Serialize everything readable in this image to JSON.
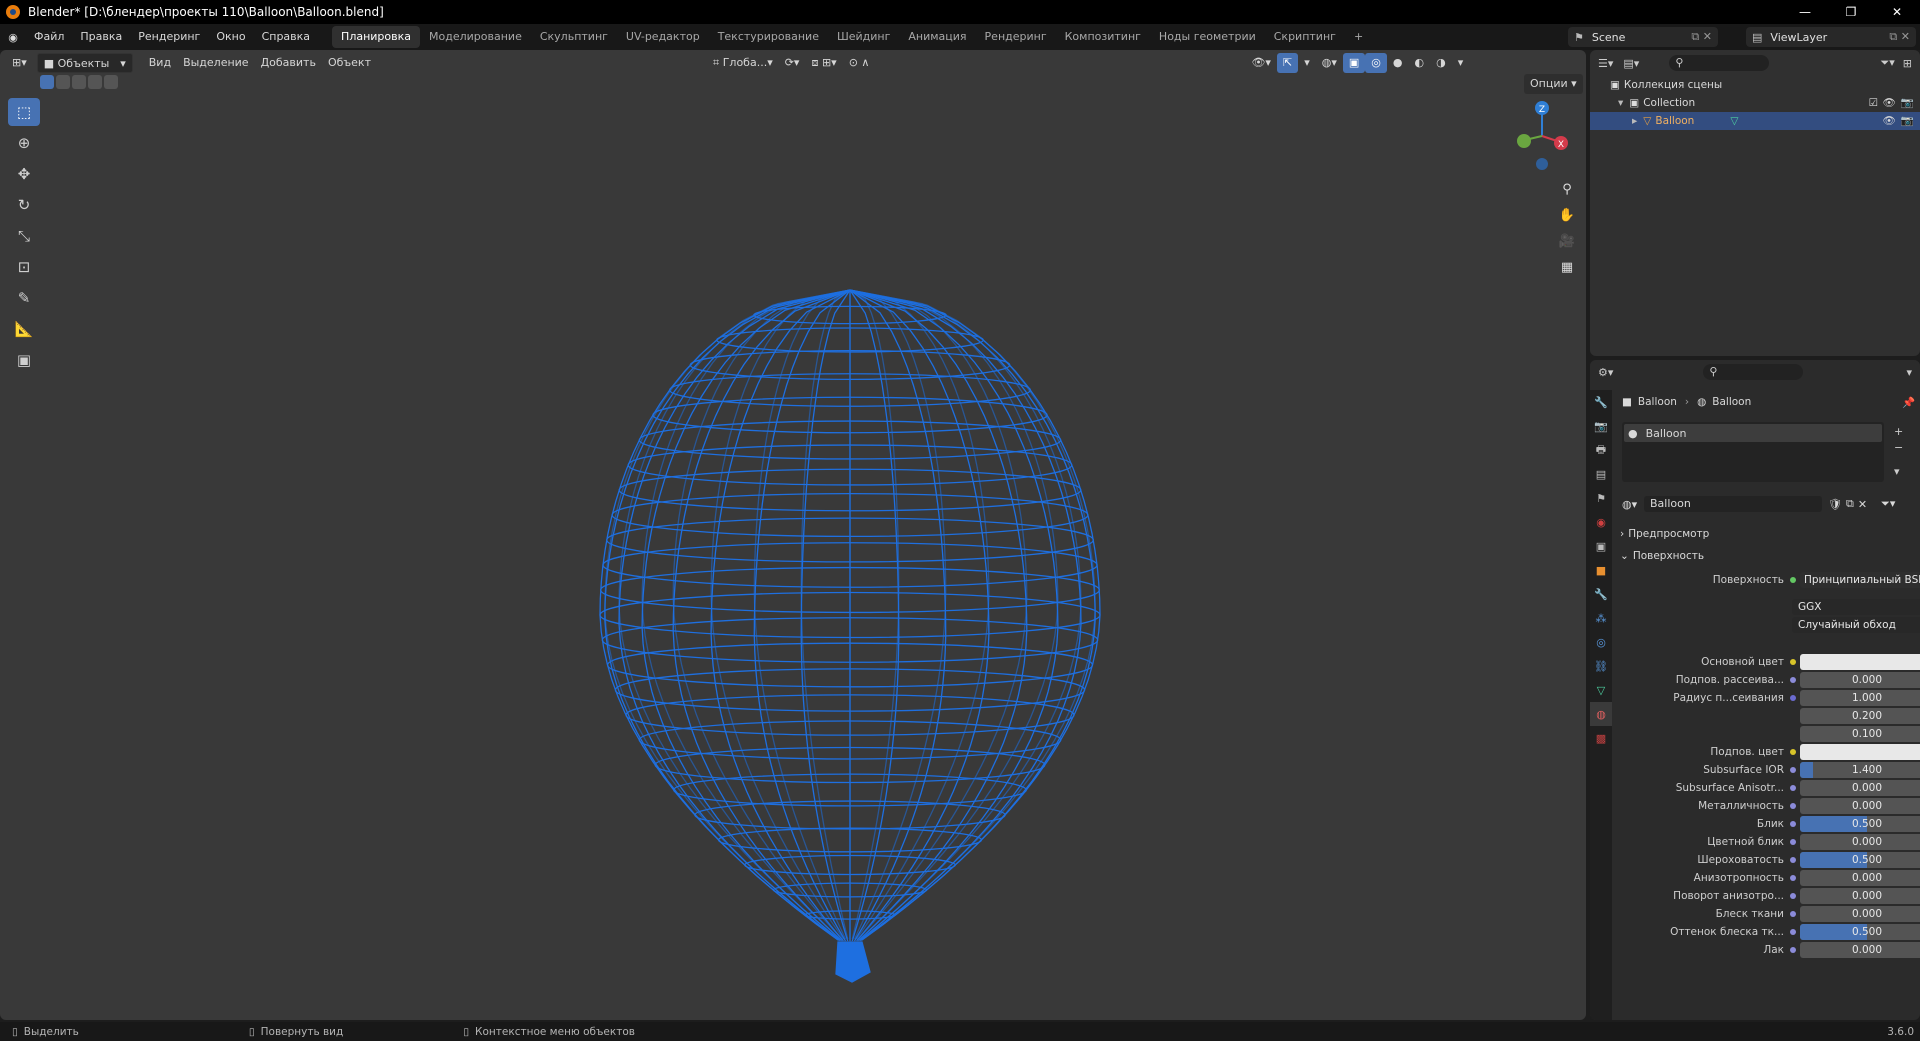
{
  "window": {
    "title": "Blender* [D:\\блендер\\проекты 110\\Balloon\\Balloon.blend]",
    "buttons": [
      "—",
      "❐",
      "✕"
    ]
  },
  "menu": [
    "Файл",
    "Правка",
    "Рендеринг",
    "Окно",
    "Справка"
  ],
  "workspaces": [
    "Планировка",
    "Моделирование",
    "Скульптинг",
    "UV-редактор",
    "Текстурирование",
    "Шейдинг",
    "Анимация",
    "Рендеринг",
    "Композитинг",
    "Ноды геометрии",
    "Скриптинг",
    "+"
  ],
  "active_workspace": "Планировка",
  "scene": {
    "name": "Scene",
    "view_layer": "ViewLayer"
  },
  "viewport": {
    "mode": "Объекты",
    "menus": [
      "Вид",
      "Выделение",
      "Добавить",
      "Объект"
    ],
    "transform_orientation": "Глоба...",
    "options": "Опции",
    "wire_color": "#1e6fe0",
    "gizmo": {
      "z": "Z",
      "x": "X"
    }
  },
  "outliner": {
    "scene_collection": "Коллекция сцены",
    "collection": "Collection",
    "object": "Balloon"
  },
  "properties": {
    "breadcrumb": [
      "Balloon",
      "Balloon"
    ],
    "slot": "Balloon",
    "material_name": "Balloon",
    "panels": {
      "preview": "Предпросмотр",
      "surface": "Поверхность"
    },
    "surface_label": "Поверхность",
    "surface_shader": "Принципиальный BSDF",
    "distribution": "GGX",
    "subsurface_method": "Случайный обход",
    "fields": [
      {
        "label": "Основной цвет",
        "value": "",
        "color": "#e8e8e8",
        "dot": "#d8c42a"
      },
      {
        "label": "Подпов. рассеива...",
        "value": "0.000",
        "fill": 0,
        "dot": "#8b8bd9"
      },
      {
        "label": "Радиус п...сеивания",
        "value": "1.000",
        "fill": 0,
        "dot": "#6b6bd0"
      },
      {
        "label": "",
        "value": "0.200",
        "fill": 0
      },
      {
        "label": "",
        "value": "0.100",
        "fill": 0
      },
      {
        "label": "Подпов. цвет",
        "value": "",
        "color": "#e8e8e8",
        "dot": "#d8c42a"
      },
      {
        "label": "Subsurface IOR",
        "value": "1.400",
        "fill": 0.1,
        "dot": "#8b8bd9"
      },
      {
        "label": "Subsurface Anisotr...",
        "value": "0.000",
        "fill": 0,
        "dot": "#8b8bd9"
      },
      {
        "label": "Металличность",
        "value": "0.000",
        "fill": 0,
        "dot": "#8b8bd9"
      },
      {
        "label": "Блик",
        "value": "0.500",
        "fill": 0.5,
        "dot": "#8b8bd9"
      },
      {
        "label": "Цветной блик",
        "value": "0.000",
        "fill": 0,
        "dot": "#8b8bd9"
      },
      {
        "label": "Шероховатость",
        "value": "0.500",
        "fill": 0.5,
        "dot": "#8b8bd9"
      },
      {
        "label": "Анизотропность",
        "value": "0.000",
        "fill": 0,
        "dot": "#8b8bd9"
      },
      {
        "label": "Поворот анизотро...",
        "value": "0.000",
        "fill": 0,
        "dot": "#8b8bd9"
      },
      {
        "label": "Блеск ткани",
        "value": "0.000",
        "fill": 0,
        "dot": "#8b8bd9"
      },
      {
        "label": "Оттенок блеска тк...",
        "value": "0.500",
        "fill": 0.5,
        "dot": "#8b8bd9"
      },
      {
        "label": "Лак",
        "value": "0.000",
        "fill": 0,
        "dot": "#8b8bd9"
      }
    ]
  },
  "statusbar": {
    "select": "Выделить",
    "rotate": "Повернуть вид",
    "context": "Контекстное меню объектов",
    "version": "3.6.0"
  }
}
